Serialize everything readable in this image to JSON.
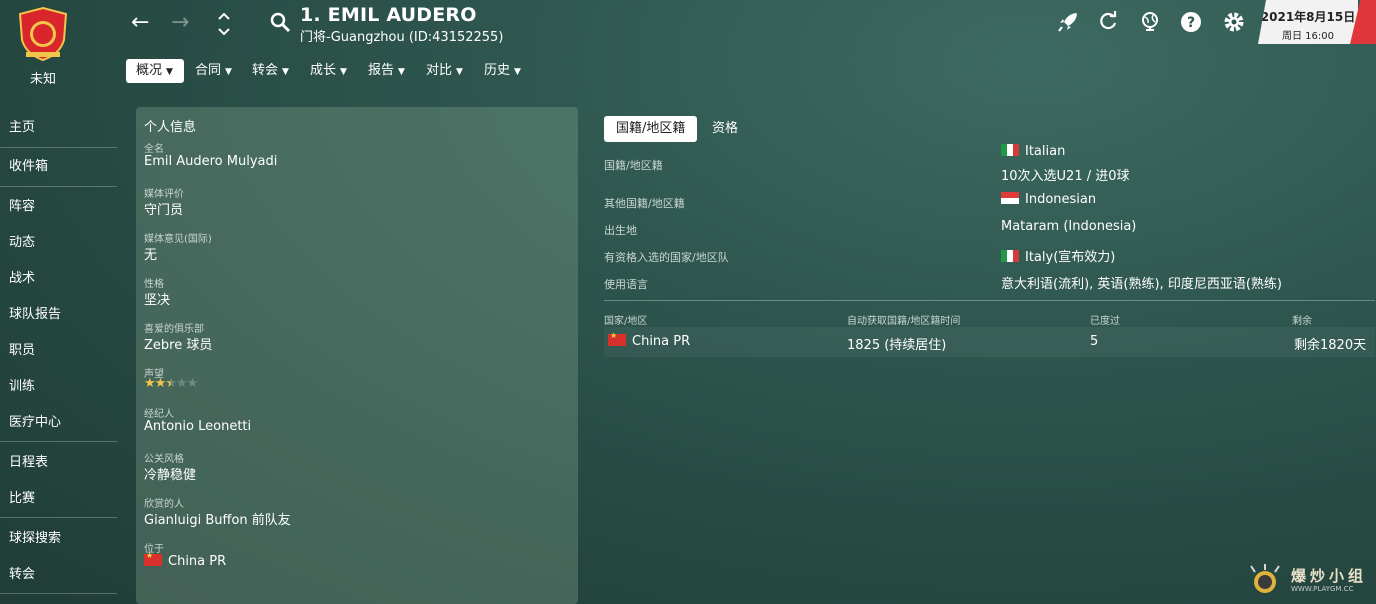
{
  "club": {
    "status": "未知"
  },
  "nav": {
    "items": [
      "主页",
      "收件箱",
      "阵容",
      "动态",
      "战术",
      "球队报告",
      "职员",
      "训练",
      "医疗中心",
      "日程表",
      "比赛",
      "球探搜索",
      "转会"
    ]
  },
  "header": {
    "player_name": "1. EMIL AUDERO",
    "player_sub": "门将-Guangzhou (ID:43152255)",
    "tabs": [
      "概况",
      "合同",
      "转会",
      "成长",
      "报告",
      "对比",
      "历史"
    ],
    "active_tab": "概况"
  },
  "date": {
    "main": "2021年8月15日",
    "time": "周日 16:00"
  },
  "colors": {
    "accent": "#e2373a",
    "background": "#2f574f"
  },
  "info": {
    "title": "个人信息",
    "fields": [
      {
        "label": "全名",
        "value": "Emil Audero Mulyadi"
      },
      {
        "label": "媒体评价",
        "value": "守门员"
      },
      {
        "label": "媒体意见(国际)",
        "value": "无"
      },
      {
        "label": "性格",
        "value": "坚决"
      },
      {
        "label": "喜爱的俱乐部",
        "value": "Zebre 球员"
      },
      {
        "label": "声望",
        "value": ""
      },
      {
        "label": "经纪人",
        "value": "Antonio Leonetti"
      },
      {
        "label": "公关风格",
        "value": "冷静稳健"
      },
      {
        "label": "欣赏的人",
        "value": "Gianluigi Buffon 前队友"
      },
      {
        "label": "位于",
        "value": "China PR"
      }
    ],
    "reputation_stars": 2.5
  },
  "nationality": {
    "tabs": [
      "国籍/地区籍",
      "资格"
    ],
    "rows": [
      {
        "label": "国籍/地区籍",
        "value": "Italian",
        "value2": "10次入选U21 / 进0球"
      },
      {
        "label": "其他国籍/地区籍",
        "value": "Indonesian"
      },
      {
        "label": "出生地",
        "value": "Mataram (Indonesia)"
      },
      {
        "label": "有资格入选的国家/地区队",
        "value": "Italy(宣布效力)"
      },
      {
        "label": "使用语言",
        "value": "意大利语(流利), 英语(熟练), 印度尼西亚语(熟练)"
      }
    ],
    "table": {
      "headers": [
        "国家/地区",
        "自动获取国籍/地区籍时间",
        "已度过",
        "剩余"
      ],
      "rows": [
        [
          "China PR",
          "1825 (持续居住)",
          "5",
          "剩余1820天"
        ]
      ]
    }
  },
  "watermark": {
    "text": "爆炒小组",
    "url": "WWW.PLAYGM.CC"
  }
}
